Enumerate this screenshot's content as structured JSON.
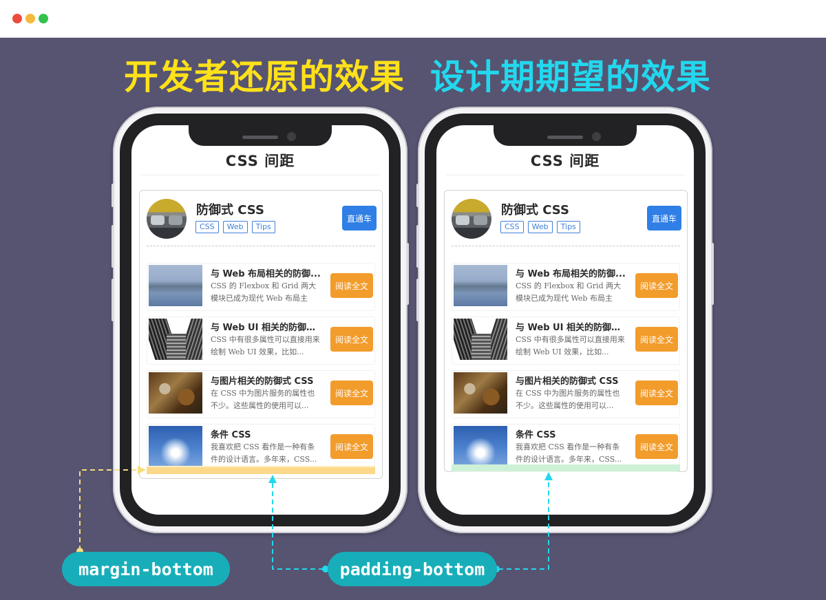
{
  "window": {
    "traffic_lights": [
      "red",
      "yellow",
      "green"
    ]
  },
  "headings": {
    "left": "开发者还原的效果",
    "right": "设计期期望的效果"
  },
  "phone": {
    "app_title": "CSS 间距",
    "author": {
      "name": "防御式 CSS",
      "tags": [
        "CSS",
        "Web",
        "Tips"
      ],
      "follow_label": "直通车"
    },
    "articles": [
      {
        "title": "与 Web 布局相关的防御...",
        "desc": "CSS 的 Flexbox 和 Grid 两大模块已成为现代 Web 布局主流...",
        "read_label": "阅读全文",
        "thumb": "lake"
      },
      {
        "title": "与 Web UI 相关的防御式...",
        "desc": "CSS 中有很多属性可以直接用来绘制 Web UI 效果，比如...",
        "read_label": "阅读全文",
        "thumb": "buildings"
      },
      {
        "title": "与图片相关的防御式 CSS",
        "desc": "在 CSS 中为图片服务的属性也不少。这些属性的使用可以...",
        "read_label": "阅读全文",
        "thumb": "leaves"
      },
      {
        "title": "条件 CSS",
        "desc": "我喜欢把 CSS 看作是一种有条件的设计语言。多年来，CSS...",
        "read_label": "阅读全文",
        "thumb": "sky"
      }
    ]
  },
  "labels": {
    "margin": "margin-bottom",
    "padding": "padding-bottom"
  },
  "colors": {
    "background": "#565471",
    "left_heading": "#ffe11a",
    "right_heading": "#22d8ee",
    "pill": "#17aeb9",
    "margin_highlight": "#fcd98a",
    "padding_highlight": "#cdf1d6",
    "follow_button": "#2f7fe6",
    "read_button": "#f29c2c"
  }
}
